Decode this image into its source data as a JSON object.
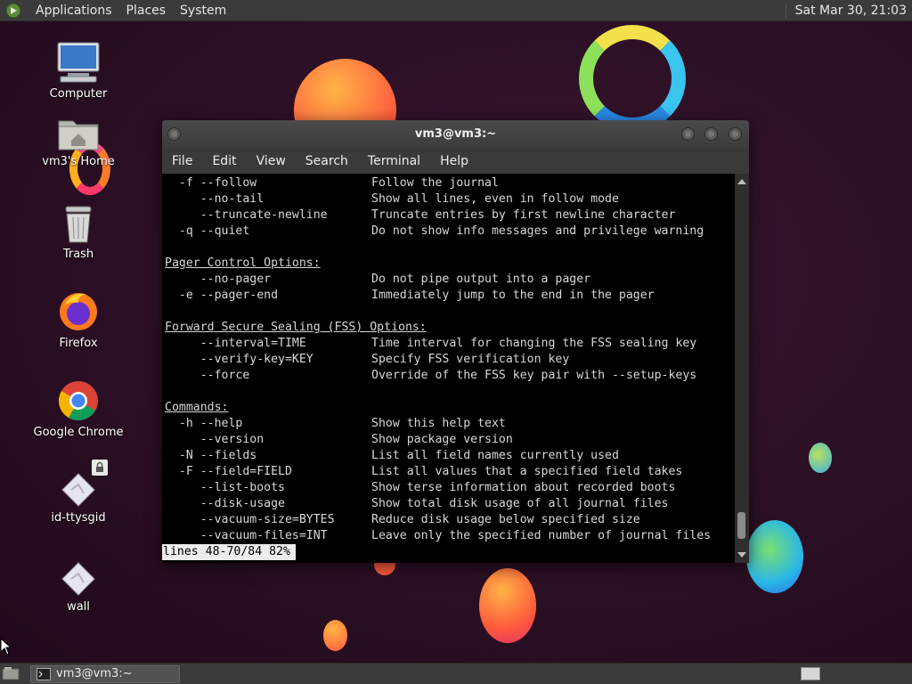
{
  "top_panel": {
    "menus": [
      "Applications",
      "Places",
      "System"
    ],
    "clock": "Sat Mar 30, 21:03"
  },
  "desktop_icons": [
    {
      "label": "Computer",
      "icon": "computer-icon"
    },
    {
      "label": "vm3's Home",
      "icon": "home-folder-icon"
    },
    {
      "label": "Trash",
      "icon": "trash-icon"
    },
    {
      "label": "Firefox",
      "icon": "firefox-icon"
    },
    {
      "label": "Google Chrome",
      "icon": "chrome-icon"
    },
    {
      "label": "id-ttysgid",
      "icon": "file-icon"
    },
    {
      "label": "wall",
      "icon": "file-icon"
    }
  ],
  "terminal": {
    "title": "vm3@vm3:~",
    "menu": [
      "File",
      "Edit",
      "View",
      "Search",
      "Terminal",
      "Help"
    ],
    "lines": [
      {
        "opt": "  -f --follow",
        "desc": "Follow the journal"
      },
      {
        "opt": "     --no-tail",
        "desc": "Show all lines, even in follow mode"
      },
      {
        "opt": "     --truncate-newline",
        "desc": "Truncate entries by first newline character"
      },
      {
        "opt": "  -q --quiet",
        "desc": "Do not show info messages and privilege warning"
      },
      {
        "text": ""
      },
      {
        "heading": "Pager Control Options:"
      },
      {
        "opt": "     --no-pager",
        "desc": "Do not pipe output into a pager"
      },
      {
        "opt": "  -e --pager-end",
        "desc": "Immediately jump to the end in the pager"
      },
      {
        "text": ""
      },
      {
        "heading": "Forward Secure Sealing (FSS) Options:"
      },
      {
        "opt": "     --interval=TIME",
        "desc": "Time interval for changing the FSS sealing key"
      },
      {
        "opt": "     --verify-key=KEY",
        "desc": "Specify FSS verification key"
      },
      {
        "opt": "     --force",
        "desc": "Override of the FSS key pair with --setup-keys"
      },
      {
        "text": ""
      },
      {
        "heading": "Commands:"
      },
      {
        "opt": "  -h --help",
        "desc": "Show this help text"
      },
      {
        "opt": "     --version",
        "desc": "Show package version"
      },
      {
        "opt": "  -N --fields",
        "desc": "List all field names currently used"
      },
      {
        "opt": "  -F --field=FIELD",
        "desc": "List all values that a specified field takes"
      },
      {
        "opt": "     --list-boots",
        "desc": "Show terse information about recorded boots"
      },
      {
        "opt": "     --disk-usage",
        "desc": "Show total disk usage of all journal files"
      },
      {
        "opt": "     --vacuum-size=BYTES",
        "desc": "Reduce disk usage below specified size"
      },
      {
        "opt": "     --vacuum-files=INT",
        "desc": "Leave only the specified number of journal files"
      }
    ],
    "status_line": "lines 48-70/84 82%"
  },
  "bottom_panel": {
    "task_label": "vm3@vm3:~"
  }
}
